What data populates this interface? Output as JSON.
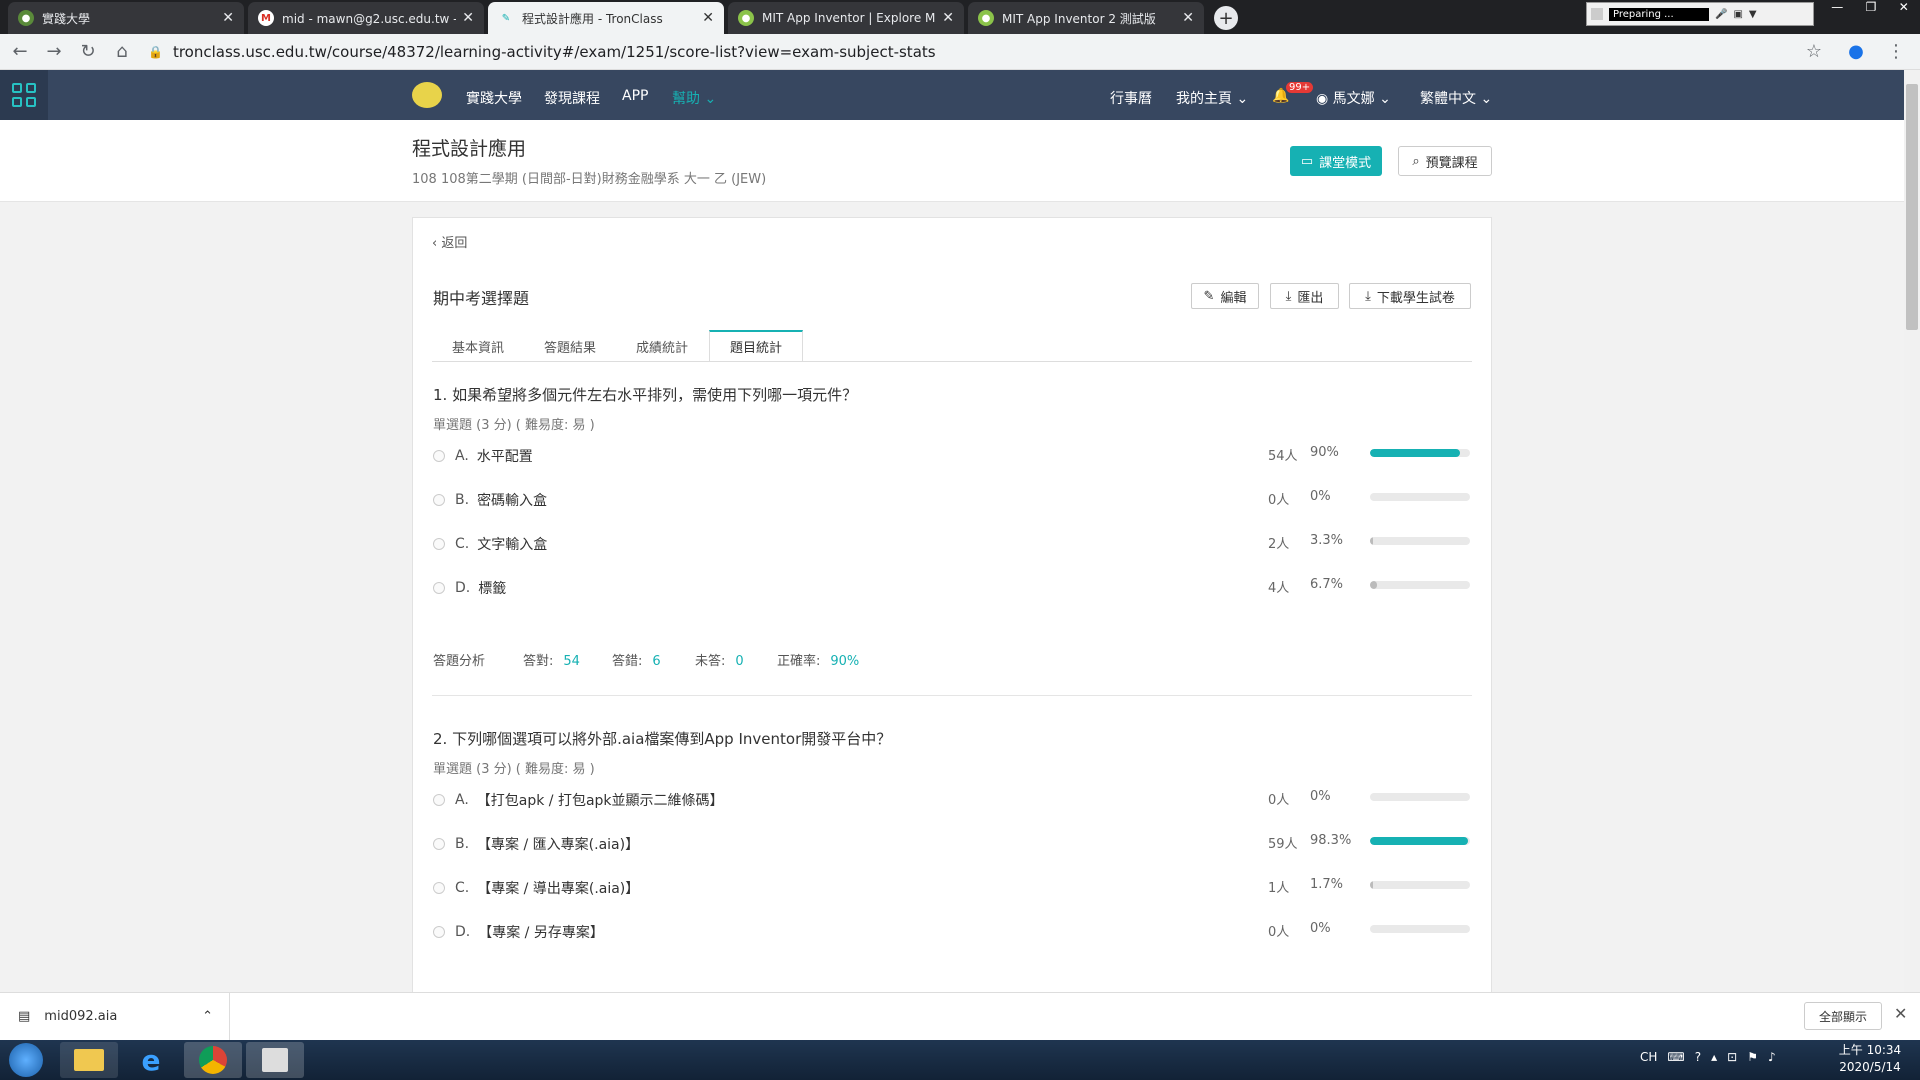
{
  "browser": {
    "tabs": [
      {
        "title": "實踐大學",
        "icon": "usc-logo-icon"
      },
      {
        "title": "mid - mawn@g2.usc.edu.tw - 實",
        "icon": "gmail-icon"
      },
      {
        "title": "程式設計應用 - TronClass",
        "icon": "tronclass-icon"
      },
      {
        "title": "MIT App Inventor | Explore MIT",
        "icon": "appinventor-icon"
      },
      {
        "title": "MIT App Inventor 2 測試版",
        "icon": "appinventor-icon"
      }
    ],
    "recorder_status": "Preparing ...",
    "url": "tronclass.usc.edu.tw/course/48372/learning-activity#/exam/1251/score-list?view=exam-subject-stats"
  },
  "sitenav": {
    "items": [
      "實踐大學",
      "發現課程",
      "APP",
      "幫助"
    ],
    "right": [
      "行事曆",
      "我的主頁",
      "99+",
      "馬文娜",
      "繁體中文"
    ]
  },
  "course": {
    "title": "程式設計應用",
    "subtitle": "108 108第二學期 (日間部-日對)財務金融學系 大一 乙 (JEW)",
    "classroom_btn": "課堂模式",
    "preview_btn": "預覽課程"
  },
  "exam": {
    "back": "返回",
    "title": "期中考選擇題",
    "actions": [
      "編輯",
      "匯出",
      "下載學生試卷"
    ],
    "tabs": [
      "基本資訊",
      "答題結果",
      "成績統計",
      "題目統計"
    ]
  },
  "questions": [
    {
      "title": "1.   如果希望將多個元件左右水平排列，需使用下列哪一項元件？",
      "meta": "單選題 (3 分) ( 難易度: 易 )",
      "options": [
        {
          "letter": "A.",
          "text": "水平配置",
          "count": "54人",
          "pct": "90%",
          "value": 0.9
        },
        {
          "letter": "B.",
          "text": "密碼輸入盒",
          "count": "0人",
          "pct": "0%",
          "value": 0
        },
        {
          "letter": "C.",
          "text": "文字輸入盒",
          "count": "2人",
          "pct": "3.3%",
          "value": 0.033
        },
        {
          "letter": "D.",
          "text": "標籤",
          "count": "4人",
          "pct": "6.7%",
          "value": 0.067
        }
      ],
      "analysis": {
        "label": "答題分析",
        "correct_label": "答對:",
        "correct": "54",
        "wrong_label": "答錯:",
        "wrong": "6",
        "blank_label": "未答:",
        "blank": "0",
        "rate_label": "正確率:",
        "rate": "90%"
      }
    },
    {
      "title": "2.   下列哪個選項可以將外部.aia檔案傳到App Inventor開發平台中？",
      "meta": "單選題 (3 分) ( 難易度: 易 )",
      "options": [
        {
          "letter": "A.",
          "text": "【打包apk / 打包apk並顯示二維條碼】",
          "count": "0人",
          "pct": "0%",
          "value": 0
        },
        {
          "letter": "B.",
          "text": "【專案 / 匯入專案(.aia)】",
          "count": "59人",
          "pct": "98.3%",
          "value": 0.983
        },
        {
          "letter": "C.",
          "text": "【專案 / 導出專案(.aia)】",
          "count": "1人",
          "pct": "1.7%",
          "value": 0.017
        },
        {
          "letter": "D.",
          "text": "【專案 / 另存專案】",
          "count": "0人",
          "pct": "0%",
          "value": 0
        }
      ]
    }
  ],
  "download": {
    "file": "mid092.aia",
    "show_all": "全部顯示"
  },
  "taskbar": {
    "lang": "CH",
    "time": "上午 10:34",
    "date": "2020/5/14"
  },
  "colors": {
    "accent": "#16b1b3",
    "nav": "#374760"
  }
}
